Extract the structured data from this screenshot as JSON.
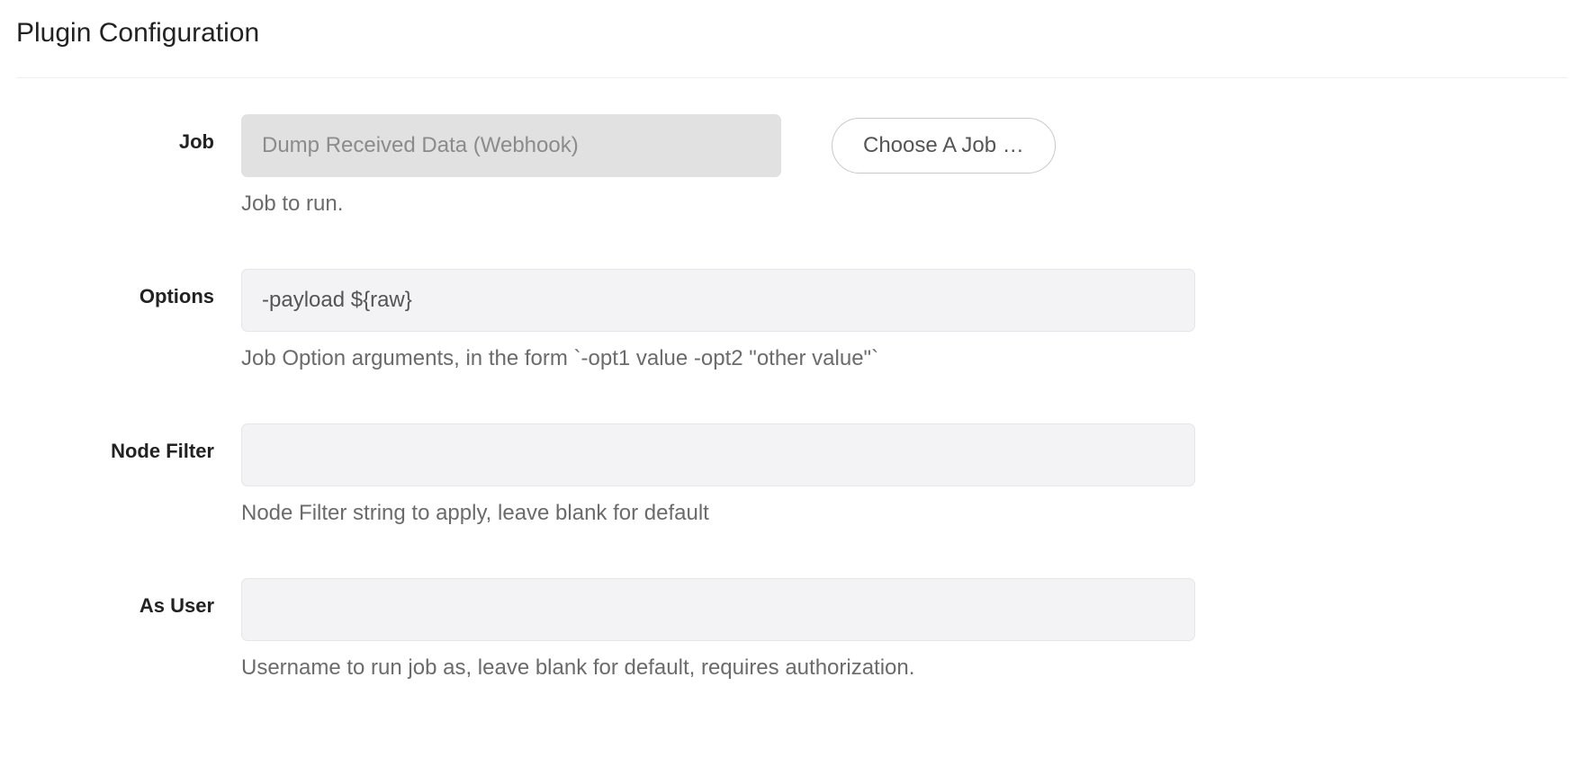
{
  "title": "Plugin Configuration",
  "fields": {
    "job": {
      "label": "Job",
      "value": "Dump Received Data (Webhook)",
      "help": "Job to run.",
      "choose_button": "Choose A Job …"
    },
    "options": {
      "label": "Options",
      "value": "-payload ${raw}",
      "help": "Job Option arguments, in the form `-opt1 value -opt2 \"other value\"`"
    },
    "node_filter": {
      "label": "Node Filter",
      "value": "",
      "help": "Node Filter string to apply, leave blank for default"
    },
    "as_user": {
      "label": "As User",
      "value": "",
      "help": "Username to run job as, leave blank for default, requires authorization."
    }
  }
}
